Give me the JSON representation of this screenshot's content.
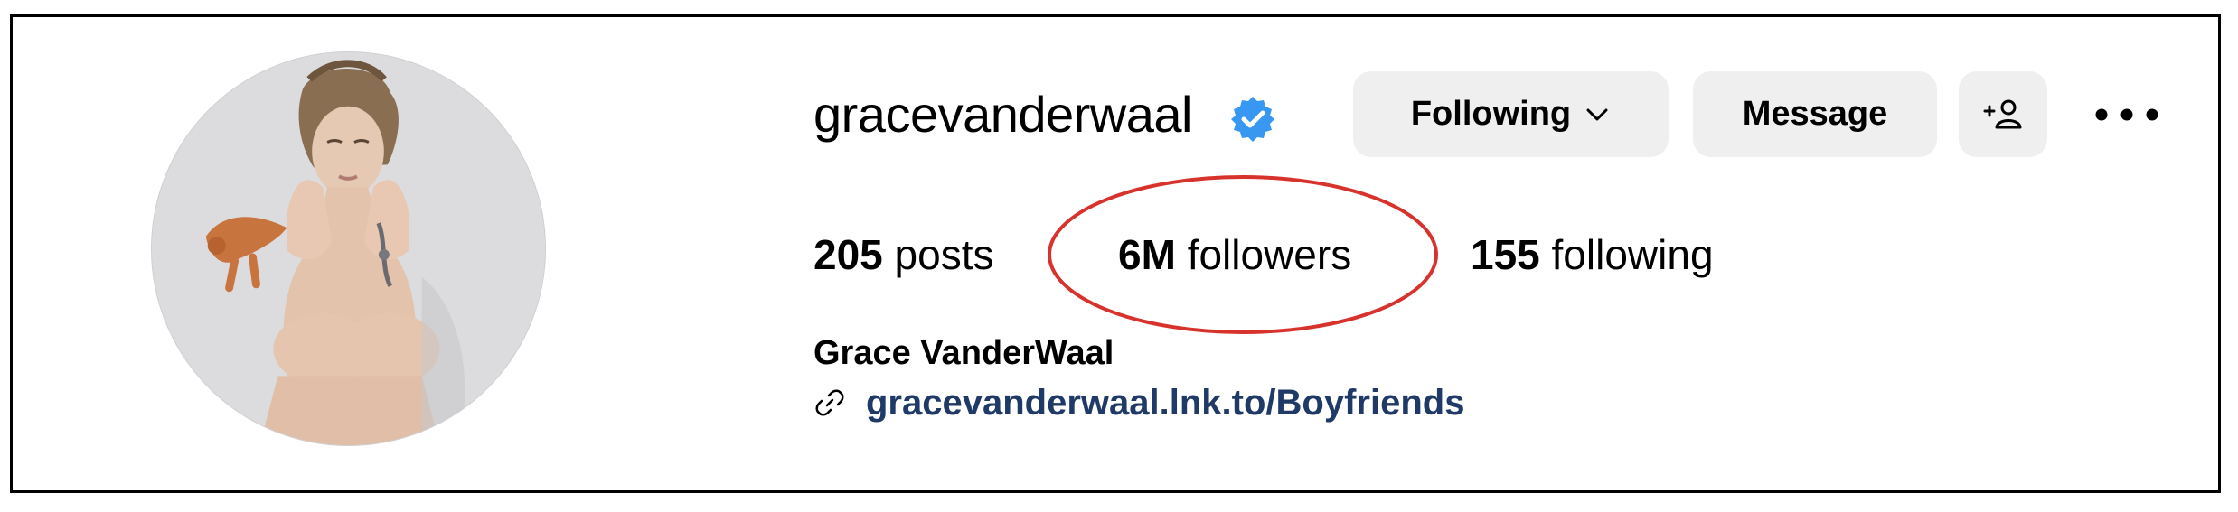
{
  "profile": {
    "username": "gracevanderwaal",
    "verified": true,
    "full_name": "Grace VanderWaal",
    "link": "gracevanderwaal.lnk.to/Boyfriends"
  },
  "actions": {
    "following_label": "Following",
    "message_label": "Message",
    "suggest_icon": "add-person-icon",
    "more_icon": "more-options-icon"
  },
  "stats": {
    "posts_count": "205",
    "posts_label": "posts",
    "followers_count": "6M",
    "followers_label": "followers",
    "following_count": "155",
    "following_label": "following"
  },
  "annotation": {
    "shape": "ellipse",
    "color": "#d7322c",
    "target": "followers"
  },
  "colors": {
    "verified_badge": "#3897f0",
    "button_bg": "#efefef",
    "link": "#1f3a66"
  }
}
